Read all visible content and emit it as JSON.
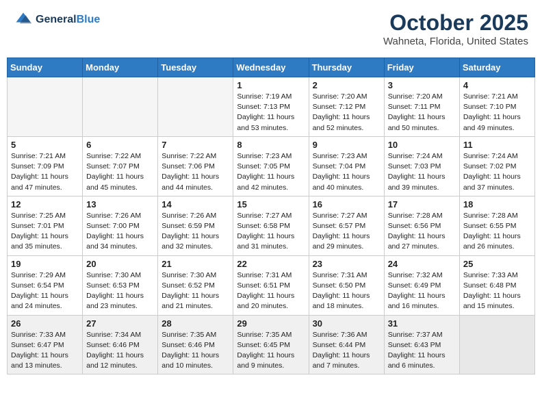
{
  "header": {
    "logo_line1": "General",
    "logo_line2": "Blue",
    "month_title": "October 2025",
    "location": "Wahneta, Florida, United States"
  },
  "weekdays": [
    "Sunday",
    "Monday",
    "Tuesday",
    "Wednesday",
    "Thursday",
    "Friday",
    "Saturday"
  ],
  "weeks": [
    [
      {
        "day": "",
        "info": ""
      },
      {
        "day": "",
        "info": ""
      },
      {
        "day": "",
        "info": ""
      },
      {
        "day": "1",
        "info": "Sunrise: 7:19 AM\nSunset: 7:13 PM\nDaylight: 11 hours\nand 53 minutes."
      },
      {
        "day": "2",
        "info": "Sunrise: 7:20 AM\nSunset: 7:12 PM\nDaylight: 11 hours\nand 52 minutes."
      },
      {
        "day": "3",
        "info": "Sunrise: 7:20 AM\nSunset: 7:11 PM\nDaylight: 11 hours\nand 50 minutes."
      },
      {
        "day": "4",
        "info": "Sunrise: 7:21 AM\nSunset: 7:10 PM\nDaylight: 11 hours\nand 49 minutes."
      }
    ],
    [
      {
        "day": "5",
        "info": "Sunrise: 7:21 AM\nSunset: 7:09 PM\nDaylight: 11 hours\nand 47 minutes."
      },
      {
        "day": "6",
        "info": "Sunrise: 7:22 AM\nSunset: 7:07 PM\nDaylight: 11 hours\nand 45 minutes."
      },
      {
        "day": "7",
        "info": "Sunrise: 7:22 AM\nSunset: 7:06 PM\nDaylight: 11 hours\nand 44 minutes."
      },
      {
        "day": "8",
        "info": "Sunrise: 7:23 AM\nSunset: 7:05 PM\nDaylight: 11 hours\nand 42 minutes."
      },
      {
        "day": "9",
        "info": "Sunrise: 7:23 AM\nSunset: 7:04 PM\nDaylight: 11 hours\nand 40 minutes."
      },
      {
        "day": "10",
        "info": "Sunrise: 7:24 AM\nSunset: 7:03 PM\nDaylight: 11 hours\nand 39 minutes."
      },
      {
        "day": "11",
        "info": "Sunrise: 7:24 AM\nSunset: 7:02 PM\nDaylight: 11 hours\nand 37 minutes."
      }
    ],
    [
      {
        "day": "12",
        "info": "Sunrise: 7:25 AM\nSunset: 7:01 PM\nDaylight: 11 hours\nand 35 minutes."
      },
      {
        "day": "13",
        "info": "Sunrise: 7:26 AM\nSunset: 7:00 PM\nDaylight: 11 hours\nand 34 minutes."
      },
      {
        "day": "14",
        "info": "Sunrise: 7:26 AM\nSunset: 6:59 PM\nDaylight: 11 hours\nand 32 minutes."
      },
      {
        "day": "15",
        "info": "Sunrise: 7:27 AM\nSunset: 6:58 PM\nDaylight: 11 hours\nand 31 minutes."
      },
      {
        "day": "16",
        "info": "Sunrise: 7:27 AM\nSunset: 6:57 PM\nDaylight: 11 hours\nand 29 minutes."
      },
      {
        "day": "17",
        "info": "Sunrise: 7:28 AM\nSunset: 6:56 PM\nDaylight: 11 hours\nand 27 minutes."
      },
      {
        "day": "18",
        "info": "Sunrise: 7:28 AM\nSunset: 6:55 PM\nDaylight: 11 hours\nand 26 minutes."
      }
    ],
    [
      {
        "day": "19",
        "info": "Sunrise: 7:29 AM\nSunset: 6:54 PM\nDaylight: 11 hours\nand 24 minutes."
      },
      {
        "day": "20",
        "info": "Sunrise: 7:30 AM\nSunset: 6:53 PM\nDaylight: 11 hours\nand 23 minutes."
      },
      {
        "day": "21",
        "info": "Sunrise: 7:30 AM\nSunset: 6:52 PM\nDaylight: 11 hours\nand 21 minutes."
      },
      {
        "day": "22",
        "info": "Sunrise: 7:31 AM\nSunset: 6:51 PM\nDaylight: 11 hours\nand 20 minutes."
      },
      {
        "day": "23",
        "info": "Sunrise: 7:31 AM\nSunset: 6:50 PM\nDaylight: 11 hours\nand 18 minutes."
      },
      {
        "day": "24",
        "info": "Sunrise: 7:32 AM\nSunset: 6:49 PM\nDaylight: 11 hours\nand 16 minutes."
      },
      {
        "day": "25",
        "info": "Sunrise: 7:33 AM\nSunset: 6:48 PM\nDaylight: 11 hours\nand 15 minutes."
      }
    ],
    [
      {
        "day": "26",
        "info": "Sunrise: 7:33 AM\nSunset: 6:47 PM\nDaylight: 11 hours\nand 13 minutes."
      },
      {
        "day": "27",
        "info": "Sunrise: 7:34 AM\nSunset: 6:46 PM\nDaylight: 11 hours\nand 12 minutes."
      },
      {
        "day": "28",
        "info": "Sunrise: 7:35 AM\nSunset: 6:46 PM\nDaylight: 11 hours\nand 10 minutes."
      },
      {
        "day": "29",
        "info": "Sunrise: 7:35 AM\nSunset: 6:45 PM\nDaylight: 11 hours\nand 9 minutes."
      },
      {
        "day": "30",
        "info": "Sunrise: 7:36 AM\nSunset: 6:44 PM\nDaylight: 11 hours\nand 7 minutes."
      },
      {
        "day": "31",
        "info": "Sunrise: 7:37 AM\nSunset: 6:43 PM\nDaylight: 11 hours\nand 6 minutes."
      },
      {
        "day": "",
        "info": ""
      }
    ]
  ]
}
